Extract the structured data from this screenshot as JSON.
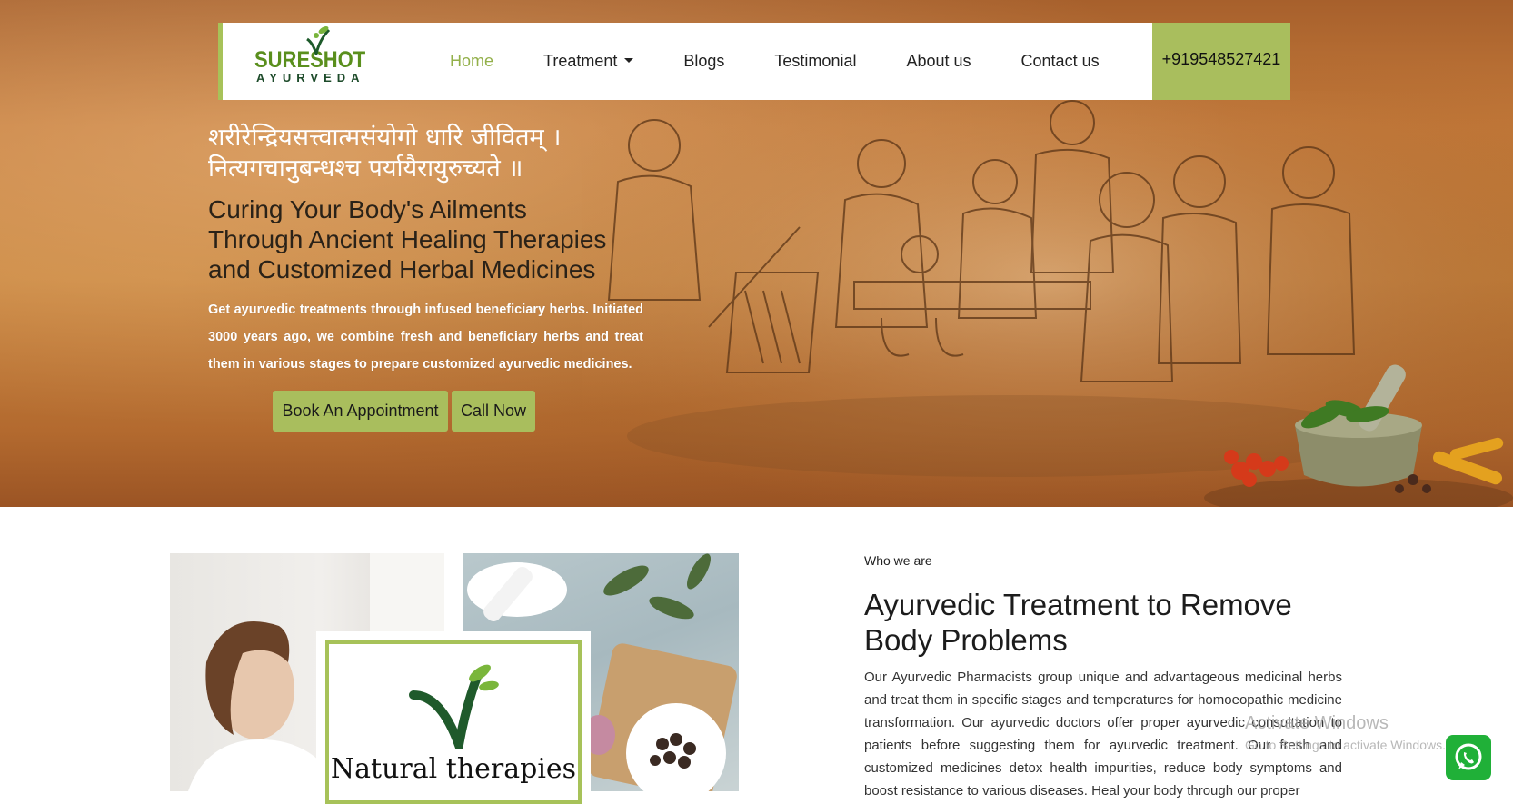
{
  "nav": {
    "logo_line1": "SURESHOT",
    "logo_line2": "AYURVEDA",
    "links": [
      {
        "label": "Home"
      },
      {
        "label": "Treatment"
      },
      {
        "label": "Blogs"
      },
      {
        "label": "Testimonial"
      },
      {
        "label": "About us"
      },
      {
        "label": "Contact us"
      }
    ],
    "phone": "+919548527421"
  },
  "hero": {
    "sanskrit_line1": "शरीरेन्द्रियसत्त्वात्मसंयोगो धारि जीवितम् ।",
    "sanskrit_line2": "नित्यगचानुबन्धश्च पर्यायैरायुरुच्यते ॥",
    "heading": "Curing Your Body's Ailments Through Ancient Healing Therapies and Customized Herbal Medicines",
    "description": "Get ayurvedic treatments through infused beneficiary herbs. Initiated 3000 years ago, we combine fresh and beneficiary herbs and treat them in various stages to prepare customized ayurvedic medicines.",
    "book_button": "Book An Appointment",
    "call_button": "Call Now"
  },
  "about": {
    "badge_text": "Natural therapies",
    "eyebrow": "Who we are",
    "heading": "Ayurvedic Treatment to Remove Body Problems",
    "paragraph": "Our Ayurvedic Pharmacists group unique and advantageous medicinal herbs and treat them in specific stages and temperatures for homoeopathic medicine transformation. Our ayurvedic doctors offer proper ayurvedic consultation to patients before suggesting them for ayurvedic treatment. Our fresh and customized medicines detox health impurities, reduce body symptoms and boost resistance to various diseases. Heal your body through our proper"
  },
  "os": {
    "watermark_title": "Activate Windows",
    "watermark_sub": "Go to Settings to activate Windows."
  },
  "colors": {
    "accent": "#a9be5d",
    "active_link": "#93b04a",
    "whatsapp": "#20b038"
  },
  "icons": [
    "leaf-v-logo-icon",
    "chevron-down-icon",
    "whatsapp-icon"
  ]
}
